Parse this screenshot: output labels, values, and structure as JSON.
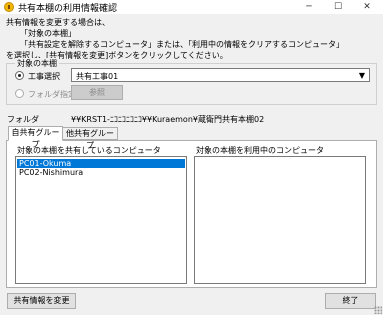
{
  "window": {
    "title": "共有本棚の利用情報確認",
    "minimize": "─",
    "maximize": "☐",
    "close": "✕"
  },
  "instructions": {
    "line1": "共有情報を変更する場合は、",
    "line2": "「対象の本棚」",
    "line3": "「共有設定を解除するコンピュータ」または、「利用中の情報をクリアするコンピュータ」",
    "line4": "を選択し、[共有情報を変更]ボタンをクリックしてください。"
  },
  "target_shelf": {
    "group_title": "対象の本棚",
    "radio_construction": "工事選択",
    "combo_value": "共有工事01",
    "radio_folder": "フォルダ指定",
    "browse_button": "参照"
  },
  "folder": {
    "label": "フォルダ",
    "path": "¥¥KRST1-ﾆｺﾆｺﾆｺﾆｺ¥¥Kuraemon¥蔵衛門共有本棚02"
  },
  "tabs": {
    "own_group": "自共有グループ",
    "other_group": "他共有グループ"
  },
  "lists": {
    "sharing_label": "対象の本棚を共有しているコンピュータ",
    "sharing_items": [
      "PC01-Okuma",
      "PC02-Nishimura"
    ],
    "in_use_label": "対象の本棚を利用中のコンピュータ",
    "in_use_items": []
  },
  "buttons": {
    "change": "共有情報を変更",
    "close": "終了"
  },
  "colors": {
    "selection": "#0078d7",
    "window_bg": "#f0f0f0"
  }
}
